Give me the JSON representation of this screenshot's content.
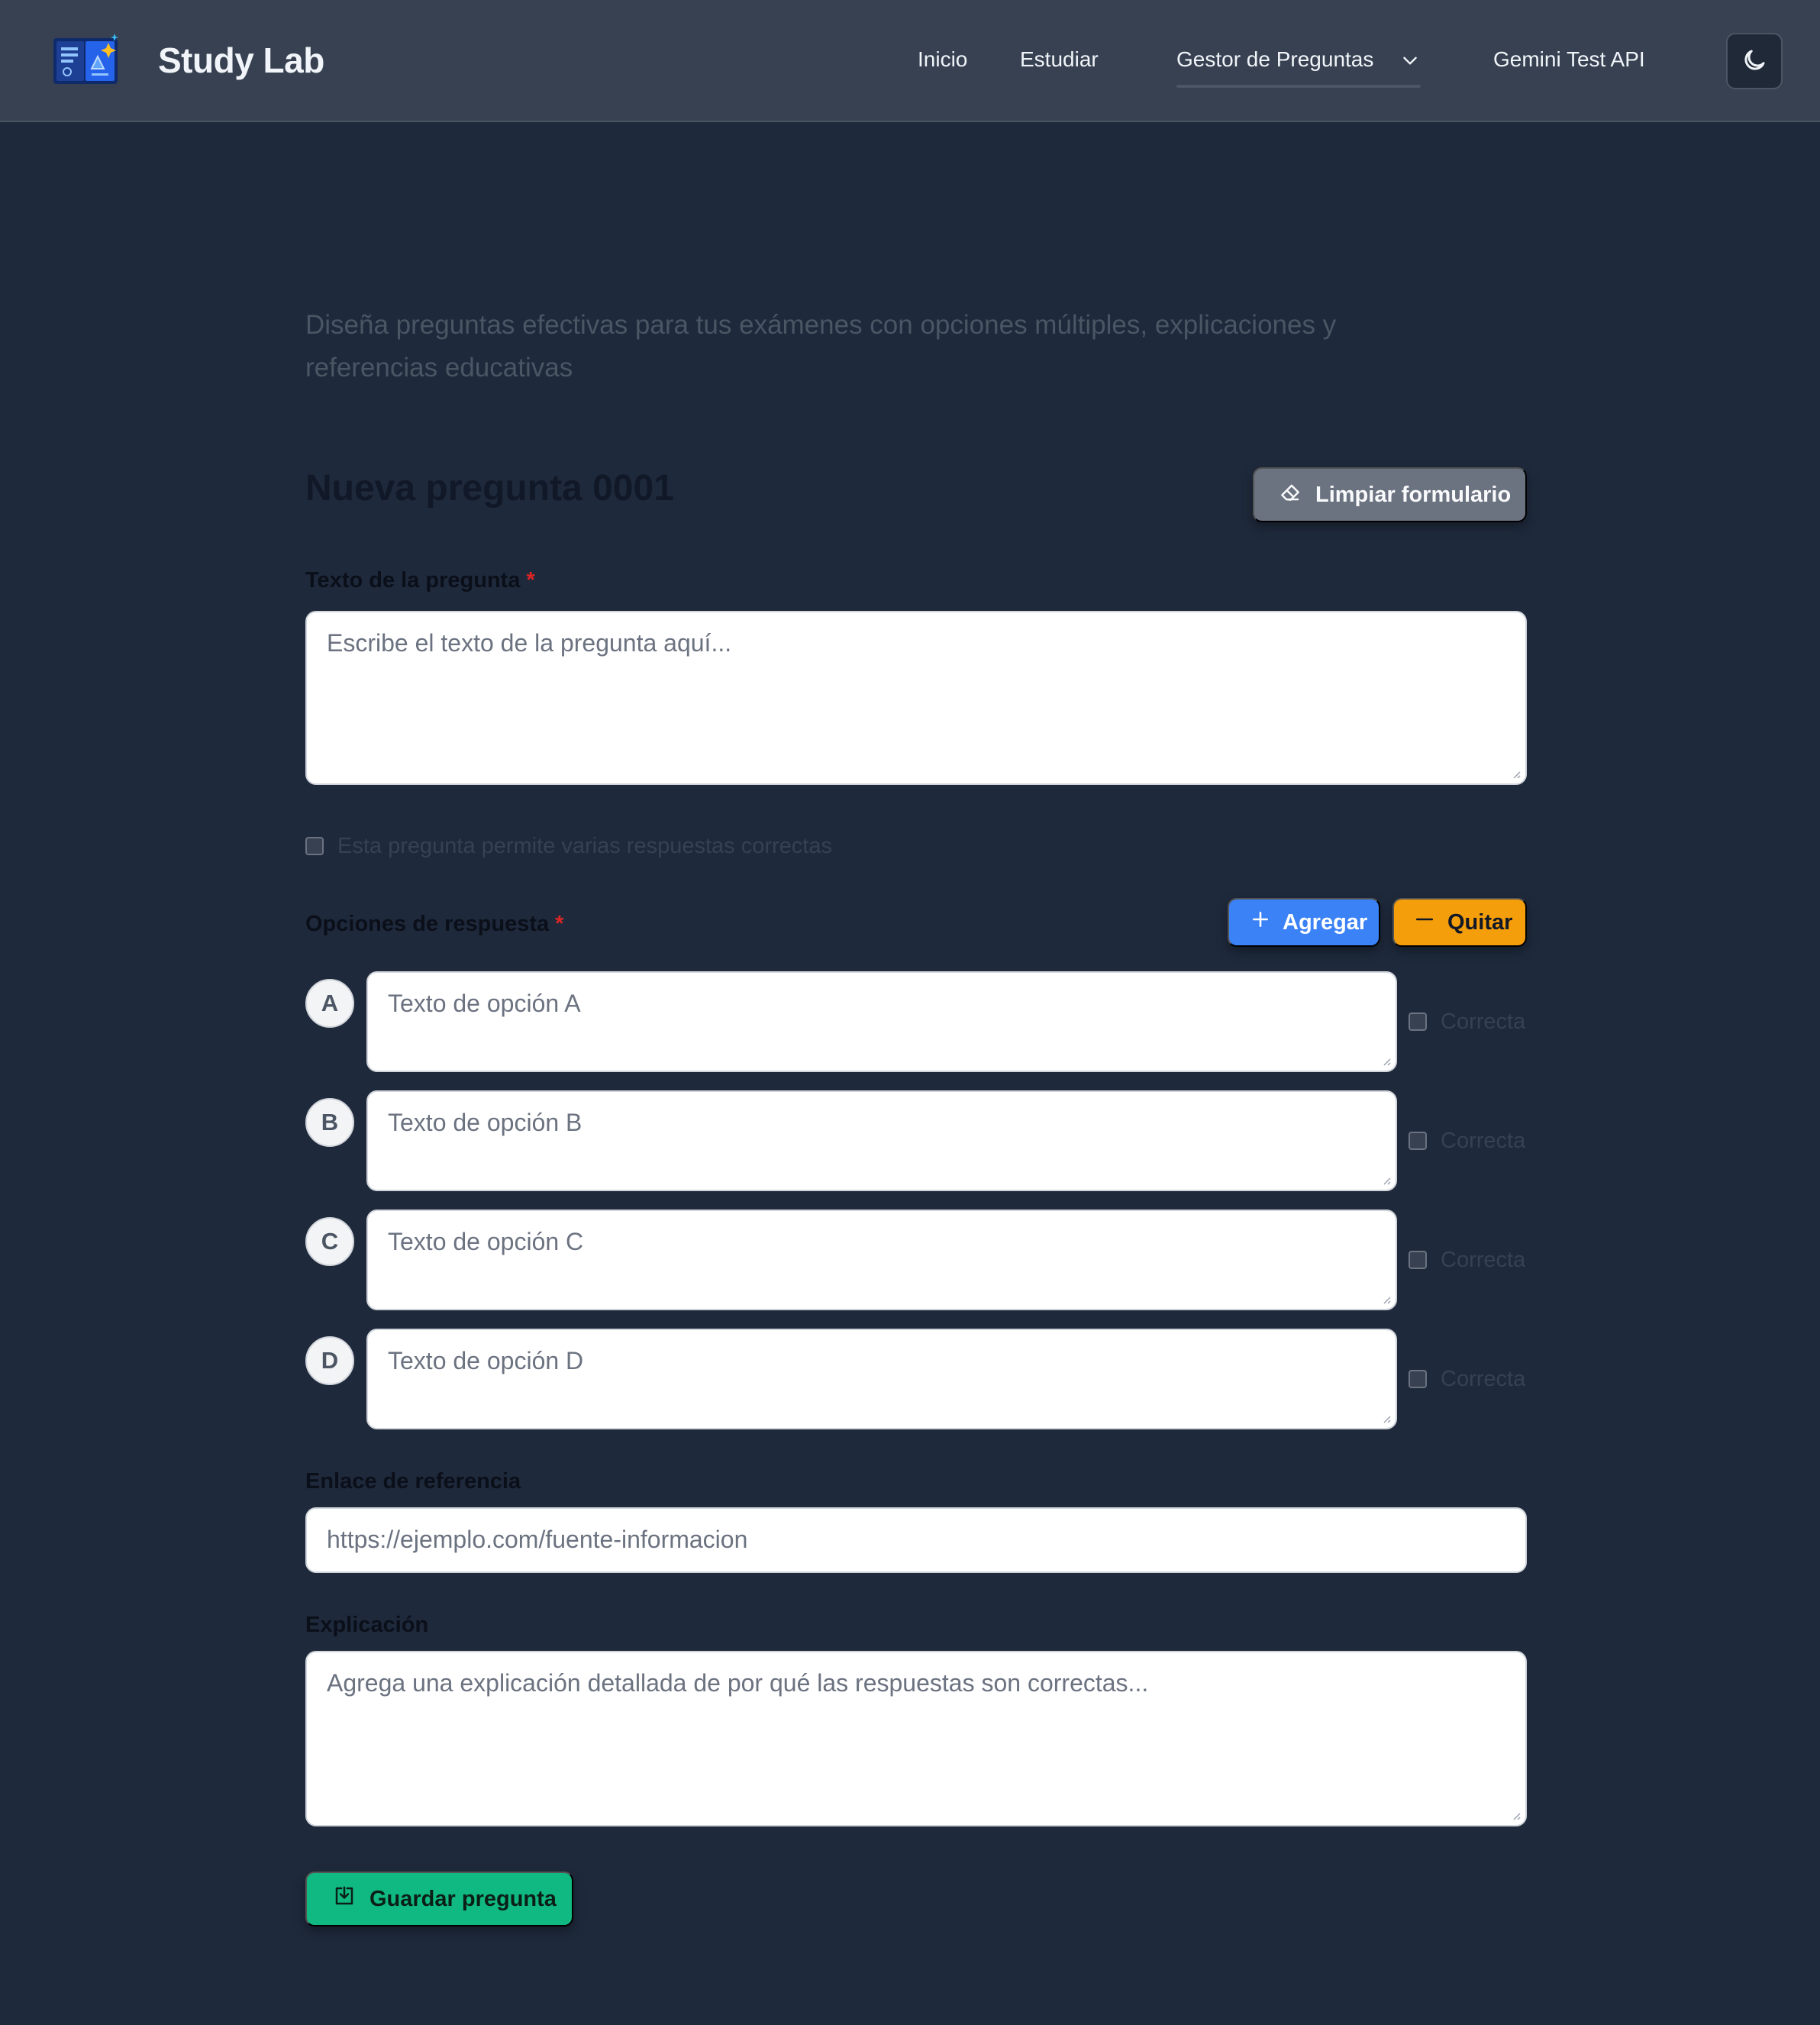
{
  "app": {
    "brand": "Study Lab"
  },
  "nav": {
    "inicio": "Inicio",
    "estudiar": "Estudiar",
    "gestor": "Gestor de Preguntas",
    "gemini": "Gemini Test API"
  },
  "page": {
    "subtitle": "Diseña preguntas efectivas para tus exámenes con opciones múltiples, explicaciones y referencias educativas",
    "form_title": "Nueva pregunta 0001",
    "clear_label": "Limpiar formulario"
  },
  "question": {
    "label": "Texto de la pregunta",
    "required_mark": "*",
    "placeholder": "Escribe el texto de la pregunta aquí...",
    "multi_label": "Esta pregunta permite varias respuestas correctas",
    "multi_checked": false
  },
  "options": {
    "label": "Opciones de respuesta",
    "required_mark": "*",
    "add_label": "Agregar",
    "remove_label": "Quitar",
    "correct_label": "Correcta",
    "items": [
      {
        "letter": "A",
        "placeholder": "Texto de opción A",
        "correct": false
      },
      {
        "letter": "B",
        "placeholder": "Texto de opción B",
        "correct": false
      },
      {
        "letter": "C",
        "placeholder": "Texto de opción C",
        "correct": false
      },
      {
        "letter": "D",
        "placeholder": "Texto de opción D",
        "correct": false
      }
    ]
  },
  "reference": {
    "label": "Enlace de referencia",
    "placeholder": "https://ejemplo.com/fuente-informacion"
  },
  "explanation": {
    "label": "Explicación",
    "placeholder": "Agrega una explicación detallada de por qué las respuestas son correctas..."
  },
  "save_label": "Guardar pregunta",
  "colors": {
    "background": "#1e293b",
    "navbar": "#374151",
    "primary": "#3b82f6",
    "warning": "#f59e0b",
    "success": "#10b981",
    "neutral": "#6b7280",
    "required": "#dc2626"
  },
  "icons": {
    "logo": "study-lab-logo",
    "theme": "moon-icon",
    "chevron": "chevron-down-icon",
    "clear": "eraser-icon",
    "add": "plus-icon",
    "remove": "minus-icon",
    "save": "save-icon"
  }
}
